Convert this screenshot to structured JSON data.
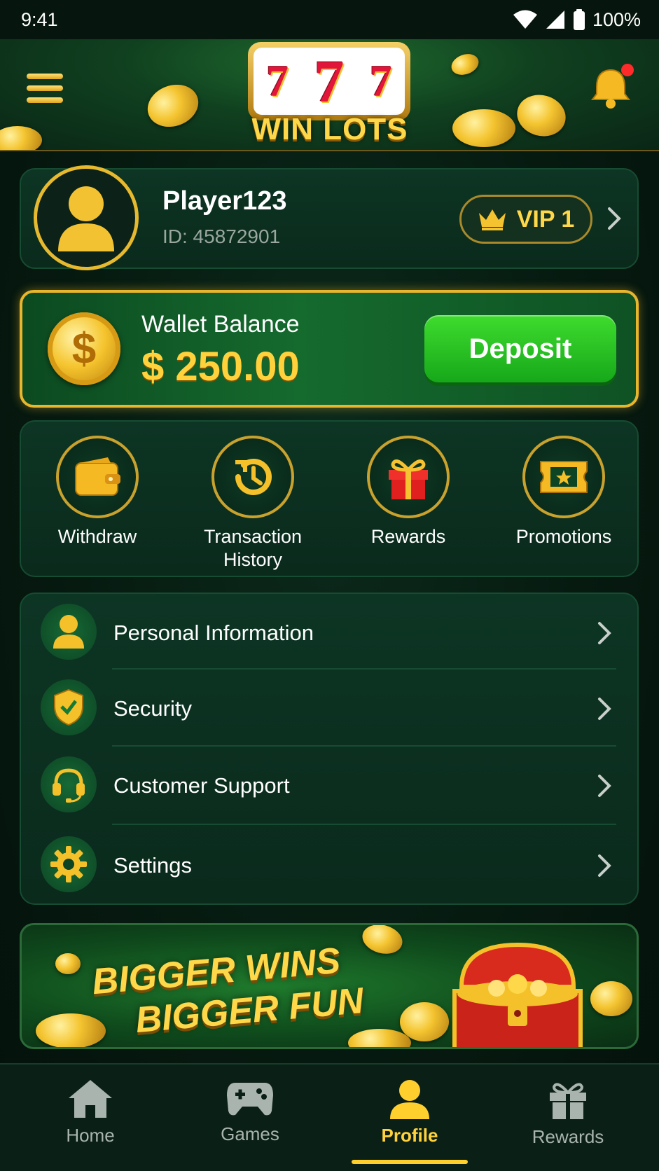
{
  "status_bar": {
    "time": "9:41",
    "battery": "100%"
  },
  "header": {
    "logo_text": "WIN LOTS",
    "logo_sevens": [
      "7",
      "7",
      "7"
    ]
  },
  "profile": {
    "name": "Player123",
    "id_text": "ID: 45872901",
    "vip_label": "VIP 1"
  },
  "wallet": {
    "label": "Wallet Balance",
    "amount": "$ 250.00",
    "coin_symbol": "$",
    "deposit_label": "Deposit"
  },
  "quick_actions": [
    {
      "label": "Withdraw",
      "icon": "wallet-icon"
    },
    {
      "label": "Transaction History",
      "icon": "history-icon"
    },
    {
      "label": "Rewards",
      "icon": "gift-icon"
    },
    {
      "label": "Promotions",
      "icon": "ticket-icon"
    }
  ],
  "menu": [
    {
      "label": "Personal Information",
      "icon": "user-icon"
    },
    {
      "label": "Security",
      "icon": "shield-icon"
    },
    {
      "label": "Customer Support",
      "icon": "headset-icon"
    },
    {
      "label": "Settings",
      "icon": "gear-icon"
    }
  ],
  "banner": {
    "line1": "BIGGER WINS",
    "line2": "BIGGER FUN"
  },
  "bottom_nav": [
    {
      "label": "Home",
      "icon": "home-icon",
      "active": false
    },
    {
      "label": "Games",
      "icon": "gamepad-icon",
      "active": false
    },
    {
      "label": "Profile",
      "icon": "profile-icon",
      "active": true
    },
    {
      "label": "Rewards",
      "icon": "gift-icon",
      "active": false
    }
  ],
  "colors": {
    "gold": "#ffd23c",
    "accent_green": "#16a81a",
    "background": "#061a10",
    "notification_dot": "#ff2a2a"
  }
}
